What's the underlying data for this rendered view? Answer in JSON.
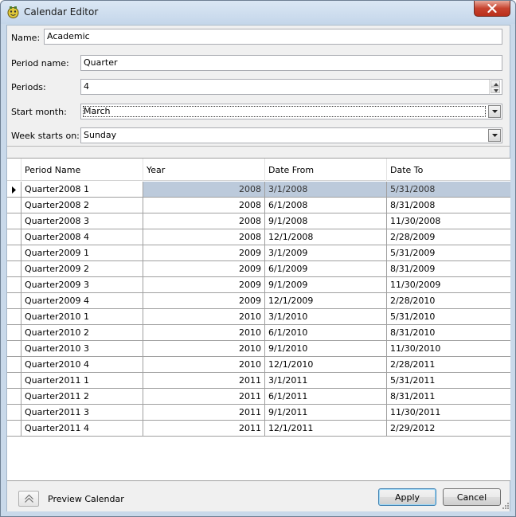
{
  "window": {
    "title": "Calendar Editor",
    "accent_color": "#c9d9ea",
    "selection_color": "#bccadb"
  },
  "form": {
    "name_label": "Name:",
    "name_value": "Academic",
    "period_name_label": "Period name:",
    "period_name_value": "Quarter",
    "periods_label": "Periods:",
    "periods_value": "4",
    "start_month_label": "Start month:",
    "start_month_value": "March",
    "week_starts_label": "Week starts on:",
    "week_starts_value": "Sunday"
  },
  "grid": {
    "columns": [
      "Period Name",
      "Year",
      "Date From",
      "Date To"
    ],
    "selected_row": 0,
    "rows": [
      {
        "period": "Quarter2008 1",
        "year": "2008",
        "from": "3/1/2008",
        "to": "5/31/2008"
      },
      {
        "period": "Quarter2008 2",
        "year": "2008",
        "from": "6/1/2008",
        "to": "8/31/2008"
      },
      {
        "period": "Quarter2008 3",
        "year": "2008",
        "from": "9/1/2008",
        "to": "11/30/2008"
      },
      {
        "period": "Quarter2008 4",
        "year": "2008",
        "from": "12/1/2008",
        "to": "2/28/2009"
      },
      {
        "period": "Quarter2009 1",
        "year": "2009",
        "from": "3/1/2009",
        "to": "5/31/2009"
      },
      {
        "period": "Quarter2009 2",
        "year": "2009",
        "from": "6/1/2009",
        "to": "8/31/2009"
      },
      {
        "period": "Quarter2009 3",
        "year": "2009",
        "from": "9/1/2009",
        "to": "11/30/2009"
      },
      {
        "period": "Quarter2009 4",
        "year": "2009",
        "from": "12/1/2009",
        "to": "2/28/2010"
      },
      {
        "period": "Quarter2010 1",
        "year": "2010",
        "from": "3/1/2010",
        "to": "5/31/2010"
      },
      {
        "period": "Quarter2010 2",
        "year": "2010",
        "from": "6/1/2010",
        "to": "8/31/2010"
      },
      {
        "period": "Quarter2010 3",
        "year": "2010",
        "from": "9/1/2010",
        "to": "11/30/2010"
      },
      {
        "period": "Quarter2010 4",
        "year": "2010",
        "from": "12/1/2010",
        "to": "2/28/2011"
      },
      {
        "period": "Quarter2011 1",
        "year": "2011",
        "from": "3/1/2011",
        "to": "5/31/2011"
      },
      {
        "period": "Quarter2011 2",
        "year": "2011",
        "from": "6/1/2011",
        "to": "8/31/2011"
      },
      {
        "period": "Quarter2011 3",
        "year": "2011",
        "from": "9/1/2011",
        "to": "11/30/2011"
      },
      {
        "period": "Quarter2011 4",
        "year": "2011",
        "from": "12/1/2011",
        "to": "2/29/2012"
      }
    ]
  },
  "footer": {
    "preview_label": "Preview Calendar",
    "apply_label": "Apply",
    "cancel_label": "Cancel"
  },
  "icons": {
    "app": "calendar-app-icon",
    "close": "close-icon",
    "row_pointer": "row-pointer-icon",
    "collapse": "chevron-up-icon",
    "dropdown": "chevron-down-icon"
  }
}
